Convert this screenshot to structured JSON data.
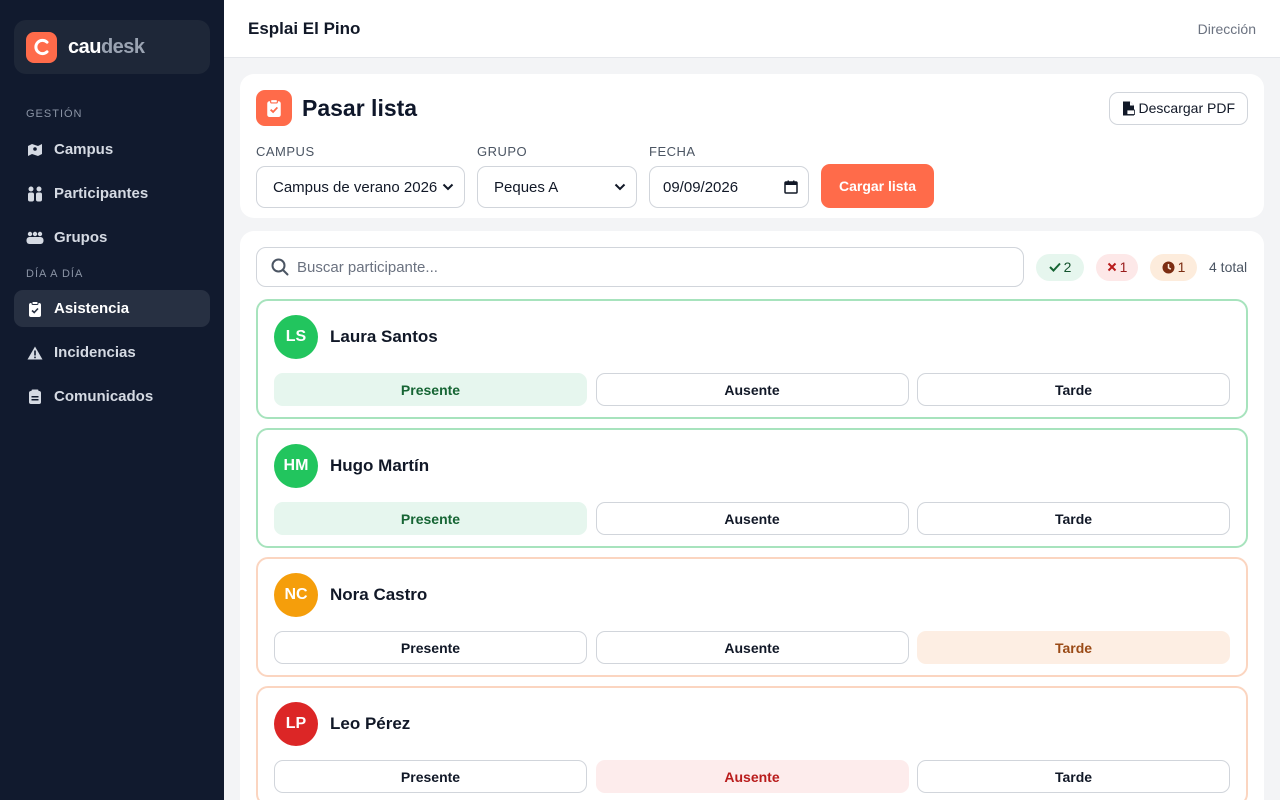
{
  "brand": {
    "part1": "cau",
    "part2": "desk",
    "accent": "#ff6b4a"
  },
  "sidebar": {
    "section_gestion": "GESTIÓN",
    "section_dia": "DÍA A DÍA",
    "items": [
      {
        "label": "Campus",
        "icon": "map-icon"
      },
      {
        "label": "Participantes",
        "icon": "people-icon"
      },
      {
        "label": "Grupos",
        "icon": "group-icon"
      },
      {
        "label": "Asistencia",
        "icon": "clipboard-check-icon",
        "active": true
      },
      {
        "label": "Incidencias",
        "icon": "warning-icon"
      },
      {
        "label": "Comunicados",
        "icon": "message-icon"
      }
    ]
  },
  "topbar": {
    "title": "Esplai El Pino",
    "role": "Dirección"
  },
  "header": {
    "title": "Pasar lista",
    "pdf_label": "Descargar PDF",
    "campus_label": "CAMPUS",
    "campus_value": "Campus de verano 2026",
    "grupo_label": "GRUPO",
    "grupo_value": "Peques A",
    "fecha_label": "FECHA",
    "fecha_value": "09/09/2026",
    "load_label": "Cargar lista"
  },
  "list": {
    "search_placeholder": "Buscar participante...",
    "count_present": "2",
    "count_absent": "1",
    "count_late": "1",
    "total": "4 total",
    "options": {
      "present": "Presente",
      "absent": "Ausente",
      "late": "Tarde"
    },
    "people": [
      {
        "initials": "LS",
        "name": "Laura Santos",
        "status": "present",
        "avatar_color": "#22c55e"
      },
      {
        "initials": "HM",
        "name": "Hugo Martín",
        "status": "present",
        "avatar_color": "#22c55e"
      },
      {
        "initials": "NC",
        "name": "Nora Castro",
        "status": "late",
        "avatar_color": "#f59e0b"
      },
      {
        "initials": "LP",
        "name": "Leo Pérez",
        "status": "absent",
        "avatar_color": "#dc2626"
      }
    ]
  }
}
